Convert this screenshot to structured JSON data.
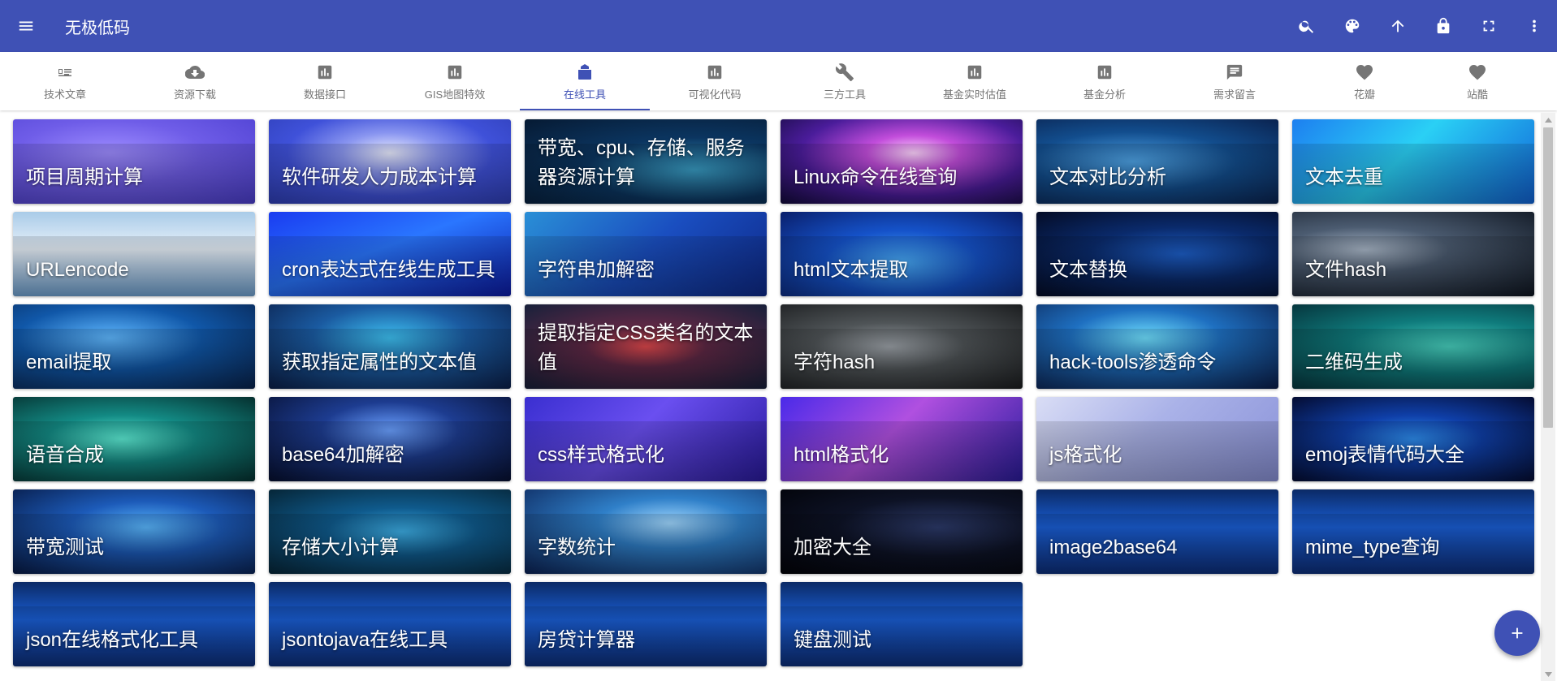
{
  "app": {
    "title": "无极低码"
  },
  "toolbar": {
    "actions": [
      {
        "name": "search-button",
        "icon": "search-icon"
      },
      {
        "name": "theme-button",
        "icon": "palette-icon"
      },
      {
        "name": "scroll-top-button",
        "icon": "arrow-up-icon"
      },
      {
        "name": "lock-button",
        "icon": "lock-icon"
      },
      {
        "name": "fullscreen-button",
        "icon": "fullscreen-icon"
      },
      {
        "name": "more-button",
        "icon": "more-vert-icon"
      }
    ]
  },
  "tabs": [
    {
      "label": "技术文章",
      "icon": "article-icon"
    },
    {
      "label": "资源下载",
      "icon": "cloud-download-icon"
    },
    {
      "label": "数据接口",
      "icon": "bar-chart-icon"
    },
    {
      "label": "GIS地图特效",
      "icon": "bar-chart-icon"
    },
    {
      "label": "在线工具",
      "icon": "tools-icon",
      "active": true
    },
    {
      "label": "可视化代码",
      "icon": "bar-chart-icon"
    },
    {
      "label": "三方工具",
      "icon": "wrench-icon"
    },
    {
      "label": "基金实时估值",
      "icon": "bar-chart-icon"
    },
    {
      "label": "基金分析",
      "icon": "bar-chart-icon"
    },
    {
      "label": "需求留言",
      "icon": "comment-icon"
    },
    {
      "label": "花瓣",
      "icon": "heart-icon"
    },
    {
      "label": "站酷",
      "icon": "heart-icon"
    }
  ],
  "cards": [
    {
      "label": "项目周期计算",
      "bg": "purple"
    },
    {
      "label": "软件研发人力成本计算",
      "bg": "oval"
    },
    {
      "label": "带宽、cpu、存储、服务器资源计算",
      "bg": "circuit"
    },
    {
      "label": "Linux命令在线查询",
      "bg": "linux"
    },
    {
      "label": "文本对比分析",
      "bg": "chip"
    },
    {
      "label": "文本去重",
      "bg": "wave"
    },
    {
      "label": "URLencode",
      "bg": "url"
    },
    {
      "label": "cron表达式在线生成工具",
      "bg": "bluewave"
    },
    {
      "label": "字符串加解密",
      "bg": "cubes"
    },
    {
      "label": "html文本提取",
      "bg": "citycubes"
    },
    {
      "label": "文本替换",
      "bg": "darkblue"
    },
    {
      "label": "文件hash",
      "bg": "at"
    },
    {
      "label": "email提取",
      "bg": "globe"
    },
    {
      "label": "获取指定属性的文本值",
      "bg": "earth"
    },
    {
      "label": "提取指定CSS类名的文本值",
      "bg": "redglow"
    },
    {
      "label": "字符hash",
      "bg": "gray"
    },
    {
      "label": "hack-tools渗透命令",
      "bg": "robot"
    },
    {
      "label": "二维码生成",
      "bg": "qr"
    },
    {
      "label": "语音合成",
      "bg": "teal"
    },
    {
      "label": "base64加解密",
      "bg": "lock"
    },
    {
      "label": "css样式格式化",
      "bg": "iso1"
    },
    {
      "label": "html格式化",
      "bg": "iso2"
    },
    {
      "label": "js格式化",
      "bg": "js"
    },
    {
      "label": "emoj表情代码大全",
      "bg": "emoji"
    },
    {
      "label": "带宽测试",
      "bg": "earth2"
    },
    {
      "label": "存储大小计算",
      "bg": "storage"
    },
    {
      "label": "字数统计",
      "bg": "hand"
    },
    {
      "label": "加密大全",
      "bg": "black"
    },
    {
      "label": "image2base64",
      "bg": "tech"
    },
    {
      "label": "mime_type查询",
      "bg": "tech"
    },
    {
      "label": "json在线格式化工具",
      "bg": "tech"
    },
    {
      "label": "jsontojava在线工具",
      "bg": "tech"
    },
    {
      "label": "房贷计算器",
      "bg": "tech"
    },
    {
      "label": "键盘测试",
      "bg": "tech"
    }
  ],
  "fab": {
    "icon": "plus-icon",
    "label": "+"
  },
  "colors": {
    "primary": "#3f51b5",
    "tab_inactive": "#757575"
  }
}
